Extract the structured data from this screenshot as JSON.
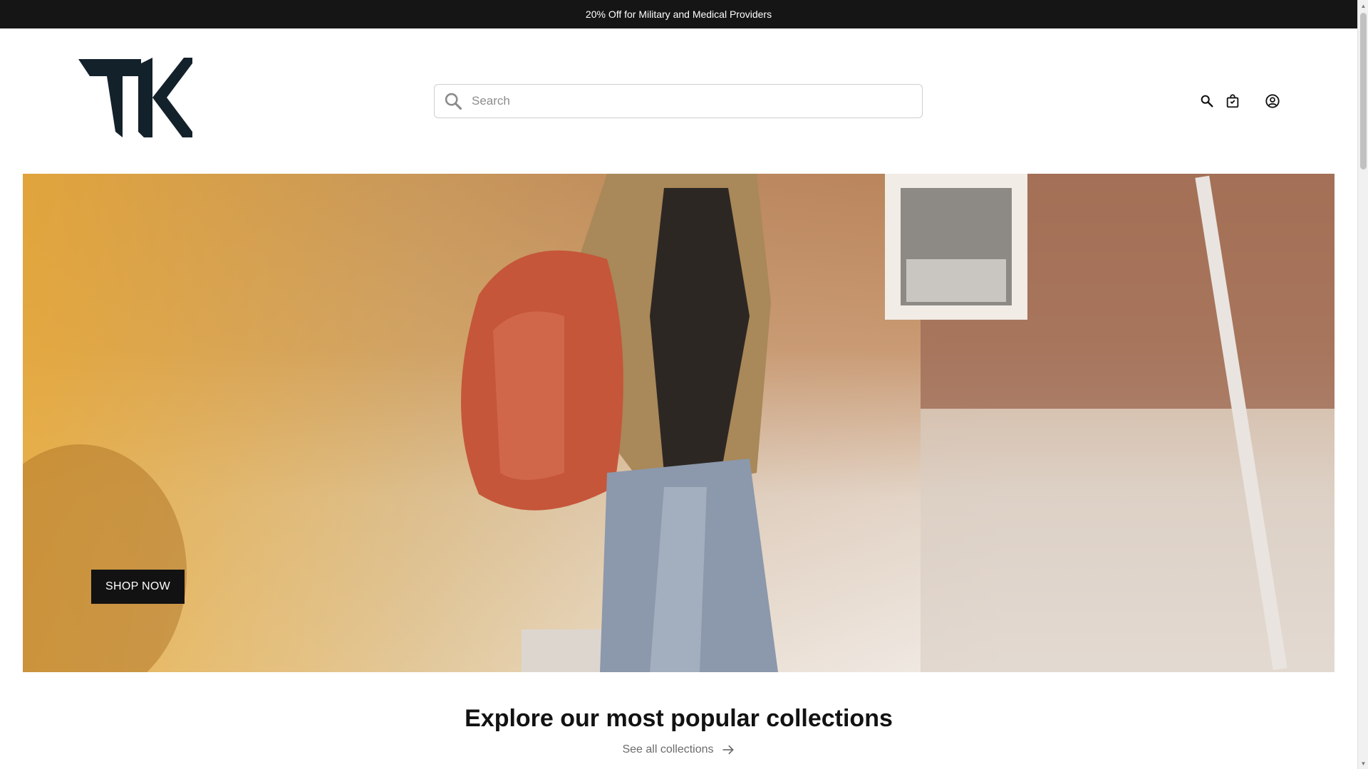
{
  "announcement": {
    "text": "20% Off for Military and Medical Providers"
  },
  "header": {
    "logo_text": "TK",
    "search": {
      "placeholder": "Search",
      "value": ""
    },
    "icons": [
      "search-icon",
      "cart-icon",
      "account-icon"
    ]
  },
  "hero": {
    "button_label": "SHOP NOW"
  },
  "collections": {
    "title": "Explore our most popular collections",
    "link_label": "See all collections"
  },
  "colors": {
    "announcement_bg": "#151515",
    "button_bg": "#121212",
    "text": "#121212",
    "muted": "#6b6b6b"
  }
}
